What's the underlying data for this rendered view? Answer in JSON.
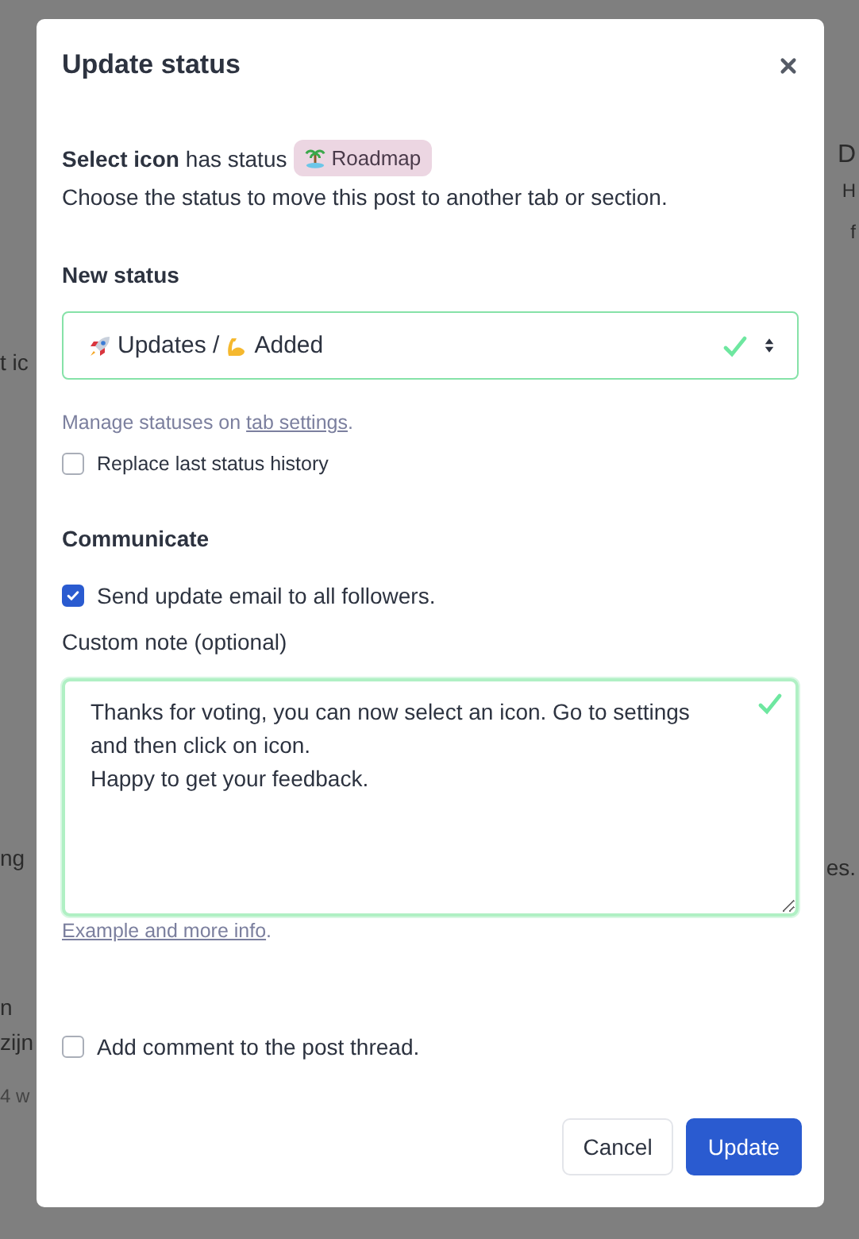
{
  "backdrop": {
    "left": [
      "t ic",
      "ng",
      "n",
      "zijn",
      "4 w"
    ],
    "right": [
      "D",
      "H",
      "f",
      "es."
    ]
  },
  "dialog": {
    "title": "Update status",
    "intro": {
      "post": "Select icon",
      "middle": "has status",
      "badge": "Roadmap",
      "line2": "Choose the status to move this post to another tab or section."
    },
    "new_status": {
      "heading": "New status",
      "value": "Updates / ",
      "value2": "Added",
      "valid": true,
      "hint": "Manage statuses on ",
      "hint_link": "tab settings",
      "hint_end": "."
    },
    "replace_history": {
      "label": "Replace last status history",
      "checked": false
    },
    "communicate": {
      "heading": "Communicate",
      "send_email": {
        "label": "Send update email to all followers.",
        "checked": true
      },
      "note_label": "Custom note (optional)",
      "note": "Thanks for voting, you can now select an icon. Go to settings and then click on icon.\nHappy to get your feedback.",
      "note_valid": true,
      "link": "Example and more info",
      "link_end": "."
    },
    "add_comment": {
      "label": "Add comment to the post thread.",
      "checked": false
    },
    "buttons": [
      {
        "label": "Cancel",
        "kind": "secondary"
      },
      {
        "label": "Update",
        "kind": "primary"
      }
    ]
  }
}
